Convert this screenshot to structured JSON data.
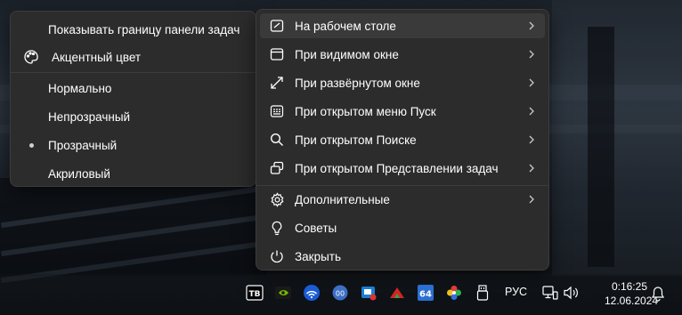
{
  "left_menu": {
    "items": [
      {
        "label": "Показывать границу панели задач",
        "icon": ""
      },
      {
        "label": "Акцентный цвет",
        "icon": "palette-icon"
      },
      {
        "label": "Нормально",
        "selected": false
      },
      {
        "label": "Непрозрачный",
        "selected": false
      },
      {
        "label": "Прозрачный",
        "selected": true
      },
      {
        "label": "Акриловый",
        "selected": false
      }
    ]
  },
  "right_menu": {
    "items": [
      {
        "label": "На рабочем столе",
        "icon": "desktop-icon",
        "submenu": true
      },
      {
        "label": "При видимом окне",
        "icon": "window-icon",
        "submenu": true
      },
      {
        "label": "При развёрнутом окне",
        "icon": "maximize-icon",
        "submenu": true
      },
      {
        "label": "При открытом меню Пуск",
        "icon": "start-menu-icon",
        "submenu": true
      },
      {
        "label": "При открытом Поиске",
        "icon": "search-icon",
        "submenu": true
      },
      {
        "label": "При открытом Представлении задач",
        "icon": "task-view-icon",
        "submenu": true
      },
      {
        "label": "Дополнительные",
        "icon": "gear-icon",
        "submenu": true
      },
      {
        "label": "Советы",
        "icon": "lightbulb-icon",
        "submenu": false
      },
      {
        "label": "Закрыть",
        "icon": "power-icon",
        "submenu": false
      }
    ]
  },
  "taskbar": {
    "tray_icons": [
      "translucenttb-icon",
      "nvidia-icon",
      "wifi-app-icon",
      "network-status-icon",
      "screen-capture-icon",
      "speed-app-icon",
      "aida64-icon",
      "color-app-icon",
      "usb-icon"
    ],
    "tray_labels": {
      "translucenttb": "TB",
      "aida64": "64"
    },
    "language": "РУС",
    "time": "0:16:25",
    "date": "12.06.2024"
  },
  "colors": {
    "menu_bg": "#2c2c2c",
    "hover_bg": "#3a3a3a",
    "separator": "#3d3d3d",
    "text": "#ffffff"
  }
}
